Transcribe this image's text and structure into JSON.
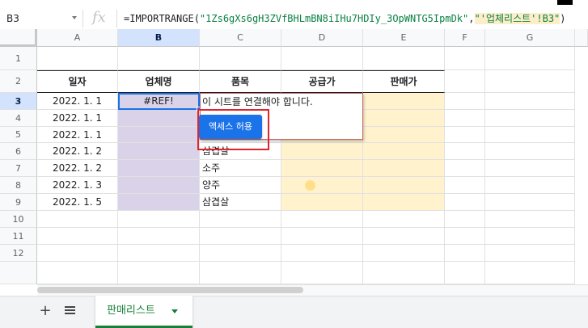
{
  "name_box": "B3",
  "formula": {
    "prefix": "=IMPORTRANGE(",
    "arg1": "\"1Zs6gXs6gH3ZVfBHLmBN8iIHu7HDIy_3OpWNTG5IpmDk\"",
    "comma": ",",
    "arg2": "\"'업체리스트'!B3\"",
    "suffix": ")"
  },
  "fx_label": "fx",
  "columns": [
    "A",
    "B",
    "C",
    "D",
    "E",
    "F",
    "G"
  ],
  "rows": [
    "1",
    "2",
    "3",
    "4",
    "5",
    "6",
    "7",
    "8",
    "9",
    "10",
    "11",
    "12"
  ],
  "table": {
    "headers": [
      "일자",
      "업체명",
      "품목",
      "공급가",
      "판매가"
    ],
    "dates": [
      "2022. 1. 1",
      "2022. 1. 1",
      "2022. 1. 1",
      "2022. 1. 2",
      "2022. 1. 2",
      "2022. 1. 3",
      "2022. 1. 5"
    ],
    "b3_value": "#REF!",
    "items": [
      "",
      "",
      "",
      "삼겹살",
      "소주",
      "양주",
      "삼겹살"
    ]
  },
  "popup": {
    "message": "이 시트를 연결해야 합니다.",
    "allow_button": "액세스 허용"
  },
  "sheet_tab": "판매리스트",
  "colors": {
    "purple_fill": "#d9d2e9",
    "yellow_fill": "#fff2cc",
    "accent": "#1a73e8",
    "highlight": "#e0242a",
    "tab_green": "#188038"
  }
}
